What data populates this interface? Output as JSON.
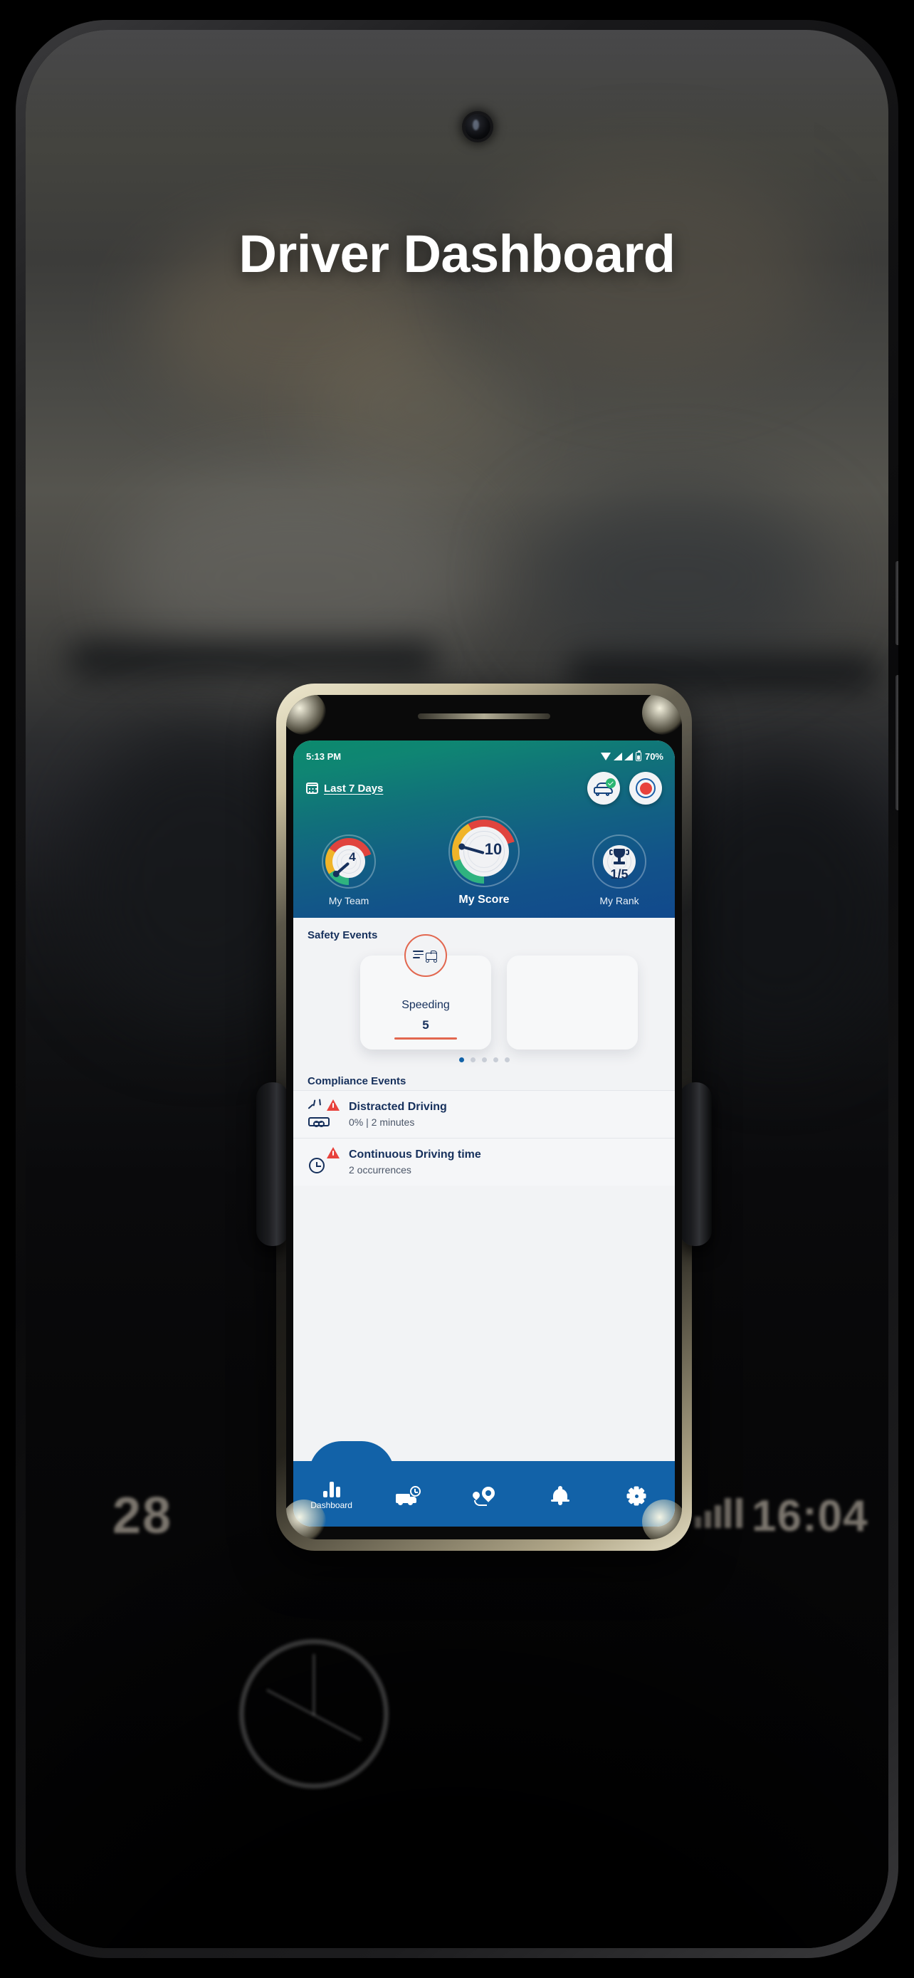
{
  "overlay": {
    "title": "Driver Dashboard"
  },
  "phone": {
    "status_bar": {
      "time": "5:13 PM",
      "wifi_icon": "wifi-icon",
      "signal_icon": "signal-bars-icon",
      "battery_icon": "battery-icon",
      "battery_percent": "70%"
    },
    "header": {
      "calendar_icon": "calendar-icon",
      "date_range_label": "Last 7 Days",
      "actions": [
        {
          "name": "vehicle-check-button",
          "icon": "car-check-icon"
        },
        {
          "name": "record-button",
          "icon": "record-icon"
        }
      ],
      "gauges": [
        {
          "label": "My Team",
          "value": "4",
          "icon": "speedometer-icon",
          "primary": false
        },
        {
          "label": "My Score",
          "value": "10",
          "icon": "speedometer-icon",
          "primary": true
        },
        {
          "label": "My Rank",
          "value": "1/5",
          "icon": "trophy-icon",
          "primary": false
        }
      ]
    },
    "safety": {
      "section_title": "Safety Events",
      "card": {
        "icon": "speeding-truck-icon",
        "title": "Speeding",
        "value": "5"
      },
      "dots_total": 5,
      "dots_active_index": 0
    },
    "compliance": {
      "section_title": "Compliance Events",
      "rows": [
        {
          "icon": "distracted-driving-icon",
          "warning_icon": "warning-triangle-icon",
          "title": "Distracted Driving",
          "subtitle": "0% | 2 minutes"
        },
        {
          "icon": "clock-icon",
          "warning_icon": "warning-triangle-icon",
          "title": "Continuous Driving time",
          "subtitle": "2 occurrences"
        }
      ]
    },
    "bottom_nav": [
      {
        "name": "nav-dashboard",
        "label": "Dashboard",
        "icon": "bar-chart-icon",
        "active": true
      },
      {
        "name": "nav-trips",
        "label": "",
        "icon": "truck-clock-icon",
        "active": false
      },
      {
        "name": "nav-locations",
        "label": "",
        "icon": "route-pin-icon",
        "active": false
      },
      {
        "name": "nav-notifications",
        "label": "",
        "icon": "bell-icon",
        "active": false
      },
      {
        "name": "nav-settings",
        "label": "",
        "icon": "gear-icon",
        "active": false
      }
    ]
  },
  "background": {
    "dash_reading_left": "28",
    "dash_reading_time": "16:04"
  },
  "colors": {
    "header_green": "#0c8a6d",
    "header_blue": "#11498c",
    "nav_blue": "#1262a8",
    "navy_text": "#16305c",
    "accent_orange": "#e2674f",
    "gauge_green": "#2fb37f",
    "gauge_yellow": "#f0b429",
    "gauge_red": "#e0443e",
    "warning_red": "#e8433d",
    "check_green": "#2bb673"
  }
}
